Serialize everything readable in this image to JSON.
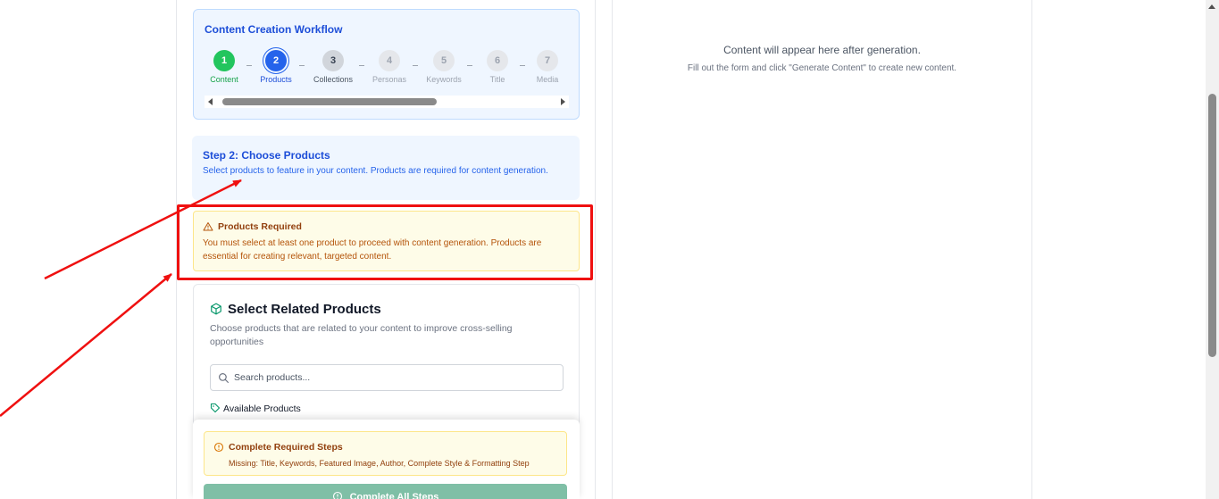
{
  "workflow": {
    "title": "Content Creation Workflow",
    "steps": [
      {
        "number": "1",
        "label": "Content",
        "state": "done"
      },
      {
        "number": "2",
        "label": "Products",
        "state": "active"
      },
      {
        "number": "3",
        "label": "Collections",
        "state": "next"
      },
      {
        "number": "4",
        "label": "Personas",
        "state": "todo"
      },
      {
        "number": "5",
        "label": "Keywords",
        "state": "todo"
      },
      {
        "number": "6",
        "label": "Title",
        "state": "todo"
      },
      {
        "number": "7",
        "label": "Media",
        "state": "todo"
      }
    ]
  },
  "step_info": {
    "title": "Step 2: Choose Products",
    "description": "Select products to feature in your content. Products are required for content generation."
  },
  "warning": {
    "title": "Products Required",
    "text": "You must select at least one product to proceed with content generation. Products are essential for creating relevant, targeted content."
  },
  "products": {
    "title": "Select Related Products",
    "description": "Choose products that are related to your content to improve cross-selling opportunities",
    "search_placeholder": "Search products...",
    "available_label": "Available Products"
  },
  "requirements": {
    "title": "Complete Required Steps",
    "missing": "Missing: Title, Keywords, Featured Image, Author, Complete Style & Formatting Step",
    "button_label": "Complete All Steps"
  },
  "output": {
    "placeholder_title": "Content will appear here after generation.",
    "placeholder_sub": "Fill out the form and click \"Generate Content\" to create new content."
  },
  "colors": {
    "accent": "#2563eb",
    "success": "#22c55e",
    "warning_bg": "#fefce8",
    "annotation_red": "#ef1010"
  }
}
